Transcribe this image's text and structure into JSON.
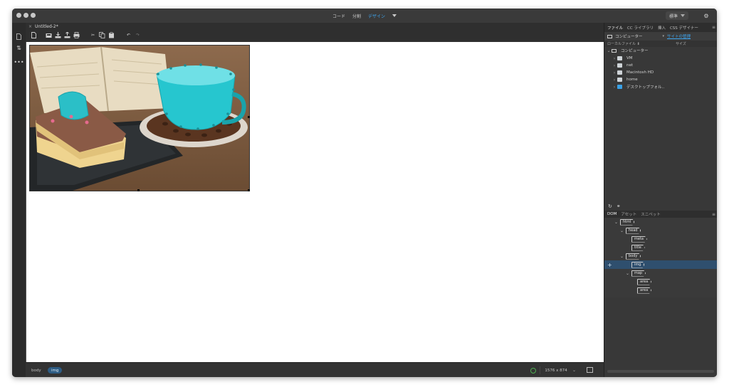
{
  "window": {
    "modes": [
      {
        "label": "コード",
        "active": false
      },
      {
        "label": "分割",
        "active": false
      },
      {
        "label": "デザイン",
        "active": true
      }
    ],
    "workspace": "標準"
  },
  "document": {
    "tab_title": "Untitled-2*",
    "close_glyph": "×"
  },
  "toolbar": {
    "icons": [
      "new-doc-icon",
      "save-icon",
      "save-all-icon",
      "upload-icon",
      "print-icon",
      "cut-icon",
      "copy-icon",
      "paste-icon",
      "undo-icon",
      "redo-icon"
    ]
  },
  "statusbar": {
    "tags": [
      {
        "label": "body",
        "selected": false
      },
      {
        "label": "img",
        "selected": true
      }
    ],
    "size": "1576 x 874",
    "status_color": "#4caf50"
  },
  "files_panel": {
    "tabs": [
      {
        "label": "ファイル",
        "active": true
      },
      {
        "label": "CC ライブラリ",
        "active": false
      },
      {
        "label": "挿入",
        "active": false
      },
      {
        "label": "CSS デザイナー",
        "active": false
      }
    ],
    "location": "コンピューター",
    "manage_link": "サイトの管理",
    "columns": {
      "name": "ローカルファイル ⬇",
      "size": "サイズ"
    },
    "tree": [
      {
        "label": "コンピューター",
        "icon": "monitor-icon",
        "level": 0,
        "expanded": true
      },
      {
        "label": "VM",
        "icon": "drive-icon",
        "level": 1
      },
      {
        "label": "net",
        "icon": "drive-icon",
        "level": 1
      },
      {
        "label": "Macintosh HD",
        "icon": "drive-icon",
        "level": 1
      },
      {
        "label": "home",
        "icon": "drive-icon",
        "level": 1
      },
      {
        "label": "デスクトップフォル‥",
        "icon": "folder-icon",
        "level": 1
      }
    ]
  },
  "dom_panel": {
    "tabs": [
      {
        "label": "DOM",
        "active": true
      },
      {
        "label": "アセット",
        "active": false
      },
      {
        "label": "スニペット",
        "active": false
      }
    ],
    "nodes": [
      {
        "tag": "html",
        "level": 0,
        "expanded": true
      },
      {
        "tag": "head",
        "level": 1,
        "expanded": true
      },
      {
        "tag": "meta",
        "level": 2
      },
      {
        "tag": "title",
        "level": 2
      },
      {
        "tag": "body",
        "level": 1,
        "expanded": true
      },
      {
        "tag": "img",
        "level": 2,
        "selected": true
      },
      {
        "tag": "map",
        "level": 2,
        "expanded": true
      },
      {
        "tag": "area",
        "level": 3
      },
      {
        "tag": "area",
        "level": 3
      }
    ]
  },
  "colors": {
    "accent": "#3ea6f0",
    "hotspot": "#26c6cf",
    "selected_row": "#2f4f6e"
  }
}
